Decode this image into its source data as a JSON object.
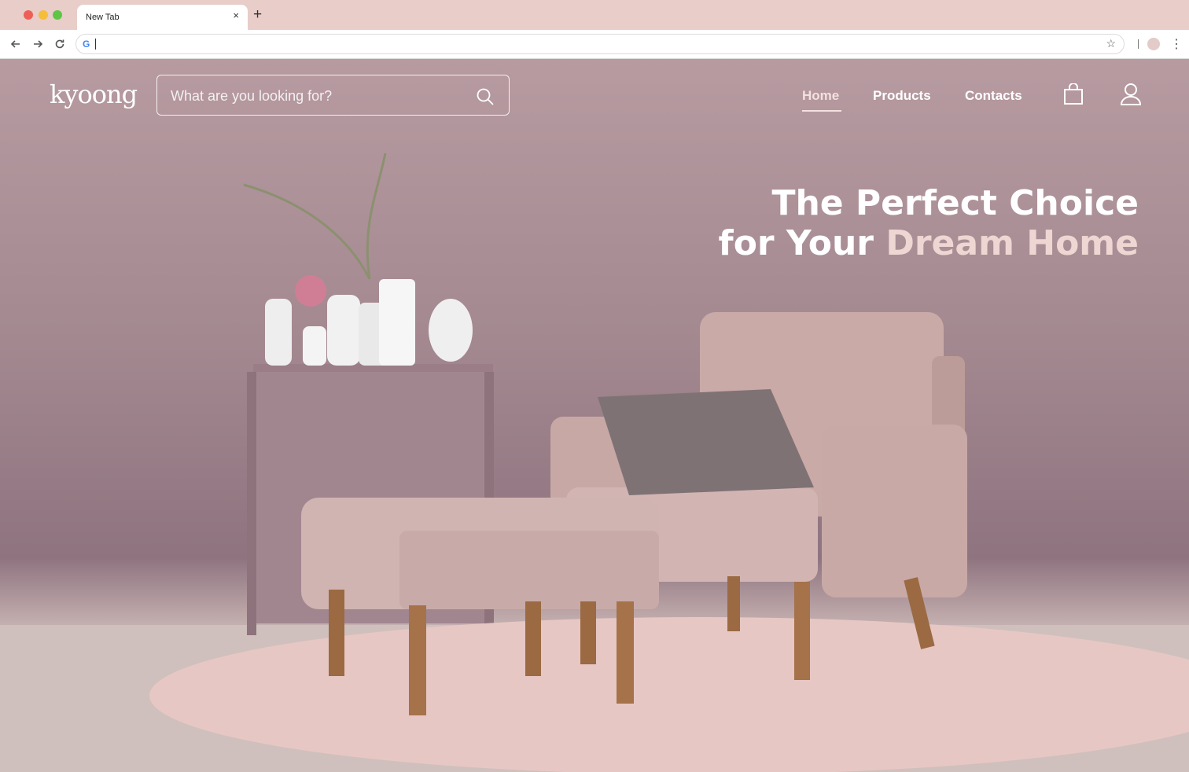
{
  "browser": {
    "tab_title": "New Tab",
    "tab_close": "×",
    "new_tab": "+",
    "omnibox_value": "",
    "icons": [
      "back-arrow-icon",
      "forward-arrow-icon",
      "reload-icon",
      "google-icon",
      "star-icon",
      "profile-icon",
      "kebab-menu-icon"
    ]
  },
  "site": {
    "logo": "kyoong",
    "search": {
      "placeholder": "What are you looking for?"
    },
    "nav": {
      "home": "Home",
      "products": "Products",
      "contacts": "Contacts"
    },
    "headline": {
      "line1": "The Perfect Choice",
      "line2_prefix": "for Your ",
      "line2_accent": "Dream Home"
    },
    "colors": {
      "accent": "#eed6d3",
      "wall": "#a38890",
      "text": "#ffffff"
    }
  }
}
